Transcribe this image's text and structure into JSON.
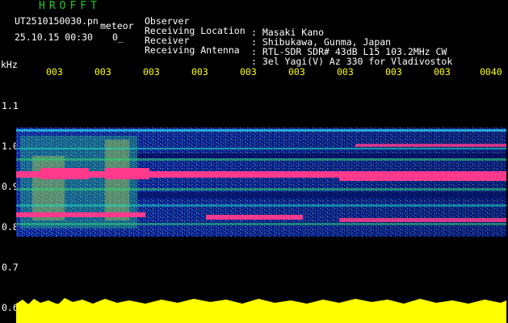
{
  "header": {
    "app_title": "HROFFT",
    "file_name": "UT2510150030.pn",
    "meteor_label": "meteor",
    "timestamp": "25.10.15 00:30",
    "count_label": "0_"
  },
  "station": [
    {
      "label": "Observer",
      "value": ": Masaki Kano"
    },
    {
      "label": "Receiving Location",
      "value": ": Shibukawa, Gunma, Japan"
    },
    {
      "label": "Receiver",
      "value": ": RTL-SDR SDR# 43dB L15 103.2MHz CW"
    },
    {
      "label": "Receiving Antenna",
      "value": ": 3el Yagi(V) Az 330 for Vladivostok"
    }
  ],
  "y_axis": {
    "unit": "kHz",
    "ticks": [
      "1.1",
      "1.0",
      "0.9",
      "0.8",
      "0.7",
      "0.6"
    ]
  },
  "time_axis": {
    "labels": [
      "003",
      "003",
      "003",
      "003",
      "003",
      "003",
      "003",
      "003",
      "003",
      "0040"
    ]
  },
  "colors": {
    "background": "#000000",
    "header_green": "#22cc22",
    "text_white": "#ffffff",
    "axis_yellow": "#ffff00",
    "band_strong": "#ff3a8c"
  }
}
